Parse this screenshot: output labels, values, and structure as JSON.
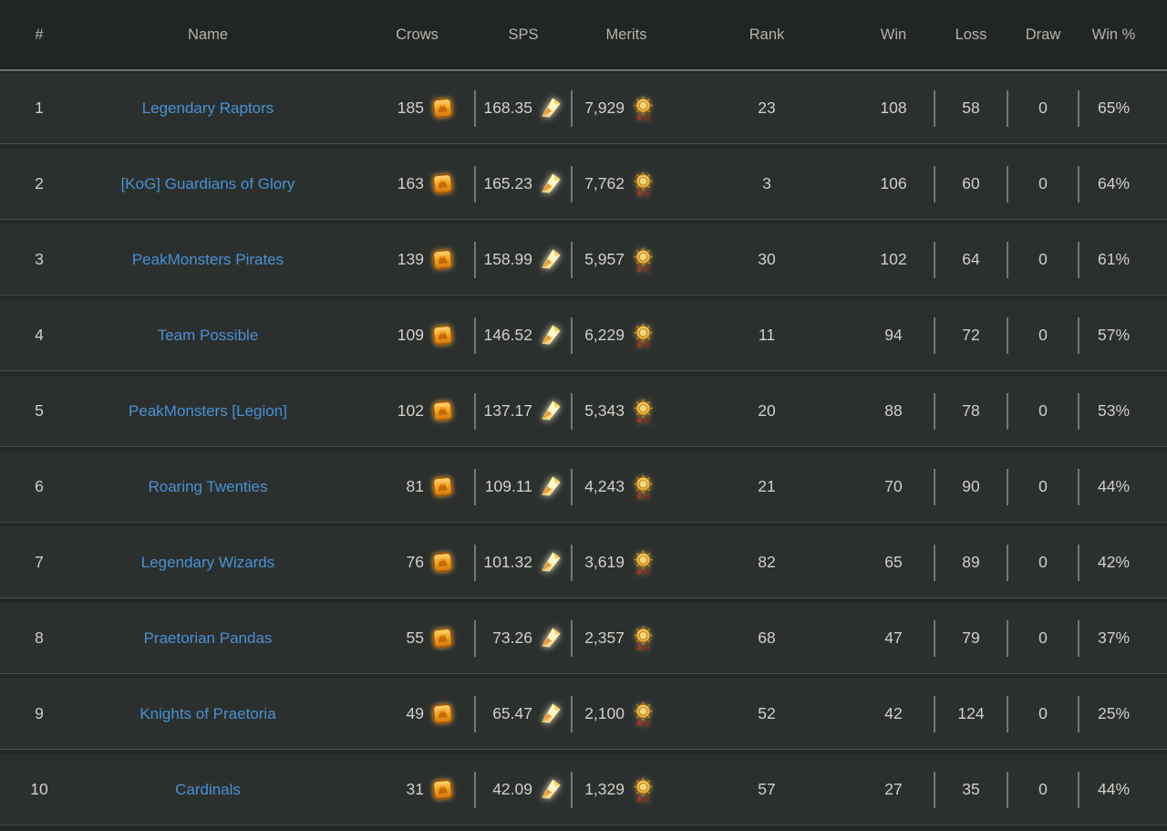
{
  "leaderboard": {
    "columns": [
      {
        "label": "#"
      },
      {
        "label": "Name"
      },
      {
        "label": "Crows"
      },
      {
        "label": "SPS"
      },
      {
        "label": "Merits"
      },
      {
        "label": "Rank"
      },
      {
        "label": "Win"
      },
      {
        "label": "Loss"
      },
      {
        "label": "Draw"
      },
      {
        "label": "Win %"
      }
    ],
    "rows": [
      {
        "num": "1",
        "name": "Legendary Raptors",
        "crows": "185",
        "sps": "168.35",
        "merits": "7,929",
        "rank": "23",
        "win": "108",
        "loss": "58",
        "draw": "0",
        "win_pct": "65%"
      },
      {
        "num": "2",
        "name": "[KoG] Guardians of Glory",
        "crows": "163",
        "sps": "165.23",
        "merits": "7,762",
        "rank": "3",
        "win": "106",
        "loss": "60",
        "draw": "0",
        "win_pct": "64%"
      },
      {
        "num": "3",
        "name": "PeakMonsters Pirates",
        "crows": "139",
        "sps": "158.99",
        "merits": "5,957",
        "rank": "30",
        "win": "102",
        "loss": "64",
        "draw": "0",
        "win_pct": "61%"
      },
      {
        "num": "4",
        "name": "Team Possible",
        "crows": "109",
        "sps": "146.52",
        "merits": "6,229",
        "rank": "11",
        "win": "94",
        "loss": "72",
        "draw": "0",
        "win_pct": "57%"
      },
      {
        "num": "5",
        "name": "PeakMonsters [Legion]",
        "crows": "102",
        "sps": "137.17",
        "merits": "5,343",
        "rank": "20",
        "win": "88",
        "loss": "78",
        "draw": "0",
        "win_pct": "53%"
      },
      {
        "num": "6",
        "name": "Roaring Twenties",
        "crows": "81",
        "sps": "109.11",
        "merits": "4,243",
        "rank": "21",
        "win": "70",
        "loss": "90",
        "draw": "0",
        "win_pct": "44%"
      },
      {
        "num": "7",
        "name": "Legendary Wizards",
        "crows": "76",
        "sps": "101.32",
        "merits": "3,619",
        "rank": "82",
        "win": "65",
        "loss": "89",
        "draw": "0",
        "win_pct": "42%"
      },
      {
        "num": "8",
        "name": "Praetorian Pandas",
        "crows": "55",
        "sps": "73.26",
        "merits": "2,357",
        "rank": "68",
        "win": "47",
        "loss": "79",
        "draw": "0",
        "win_pct": "37%"
      },
      {
        "num": "9",
        "name": "Knights of Praetoria",
        "crows": "49",
        "sps": "65.47",
        "merits": "2,100",
        "rank": "52",
        "win": "42",
        "loss": "124",
        "draw": "0",
        "win_pct": "25%"
      },
      {
        "num": "10",
        "name": "Cardinals",
        "crows": "31",
        "sps": "42.09",
        "merits": "1,329",
        "rank": "57",
        "win": "27",
        "loss": "35",
        "draw": "0",
        "win_pct": "44%"
      }
    ],
    "icons": {
      "crows": "crows-token-icon",
      "sps": "sps-shard-icon",
      "merits": "merits-medal-icon"
    },
    "colors": {
      "link_blue": "#4a90d2",
      "header_bg": "#212625",
      "row_bg": "#2b302f",
      "gap_bg": "#242827",
      "header_text": "#b6b2a9",
      "value_text": "#d2cfc7",
      "divider": "#727776"
    }
  }
}
